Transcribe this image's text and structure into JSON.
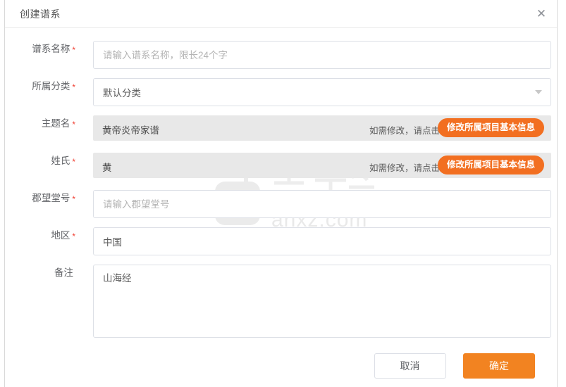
{
  "dialog": {
    "title": "创建谱系",
    "close_icon": "close-icon"
  },
  "watermark": {
    "brand": "安下载",
    "domain": "anxz.com"
  },
  "form": {
    "rows": [
      {
        "label": "谱系名称",
        "required": "*",
        "type": "input",
        "value": "",
        "placeholder": "请输入谱系名称，限长24个字"
      },
      {
        "label": "所属分类",
        "required": "*",
        "type": "select",
        "value": "默认分类",
        "chevron_icon": "chevron-down-icon"
      },
      {
        "label": "主题名",
        "required": "*",
        "type": "readonly",
        "value": "黄帝炎帝家谱",
        "hint": "如需修改，请点击",
        "action_label": "修改所属项目基本信息"
      },
      {
        "label": "姓氏",
        "required": "*",
        "type": "readonly",
        "value": "黄",
        "hint": "如需修改，请点击",
        "action_label": "修改所属项目基本信息"
      },
      {
        "label": "郡望堂号",
        "required": "*",
        "type": "input",
        "value": "",
        "placeholder": "请输入郡望堂号"
      },
      {
        "label": "地区",
        "required": "*",
        "type": "input",
        "value": "中国",
        "placeholder": ""
      },
      {
        "label": "备注",
        "required": "",
        "type": "textarea",
        "value": "山海经",
        "placeholder": ""
      }
    ]
  },
  "footer": {
    "cancel_label": "取消",
    "confirm_label": "确定"
  },
  "colors": {
    "accent_orange": "#f28321",
    "chip_orange": "#f26f21",
    "required_red": "#f04134",
    "label_gray": "#606266",
    "readonly_bg": "#e8e8e8",
    "border_gray": "#dcdfe6"
  }
}
